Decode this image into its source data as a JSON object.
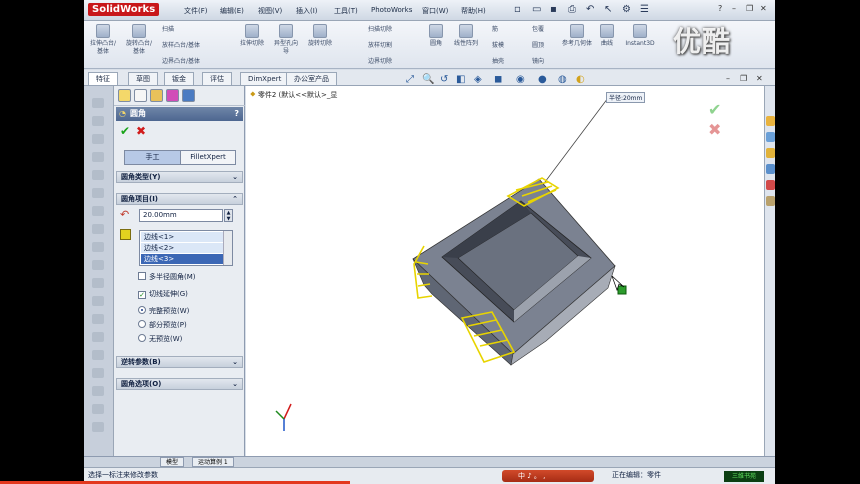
{
  "app": {
    "logo": "SolidWorks"
  },
  "menu": [
    "文件(F)",
    "编辑(E)",
    "视图(V)",
    "插入(I)",
    "工具(T)",
    "PhotoWorks",
    "窗口(W)",
    "帮助(H)"
  ],
  "watermark": "优酷",
  "ribbon": {
    "buttons": [
      "拉伸凸台/基体",
      "旋转凸台/基体",
      "拉伸切除",
      "异型孔向导",
      "旋转切除",
      "圆角",
      "线性阵列",
      "筋",
      "拔模",
      "包覆",
      "参考几何体",
      "曲线",
      "Instant3D"
    ],
    "small": [
      "扫描",
      "放样凸台/基体",
      "边界凸台/基体",
      "扫描切除",
      "放样切割",
      "边界切除",
      "圆顶",
      "抽壳",
      "镜向"
    ]
  },
  "tabs": [
    "特征",
    "草图",
    "钣金",
    "评估",
    "DimXpert",
    "办公室产品"
  ],
  "pm": {
    "title": "圆角",
    "help": "?",
    "mode_manual": "手工",
    "mode_auto": "FilletXpert",
    "group_type": "圆角类型(Y)",
    "group_items": "圆角项目(I)",
    "radius": "20.00mm",
    "edges": [
      "边线<1>",
      "边线<2>",
      "边线<3>"
    ],
    "multi_radius": "多半径圆角(M)",
    "tangent": "切线延伸(G)",
    "full_preview": "完整预览(W)",
    "partial_preview": "部分预览(P)",
    "no_preview": "无预览(W)",
    "group_setback": "逆转参数(B)",
    "group_options": "圆角选项(O)"
  },
  "viewport": {
    "tree_label": "零件2  (默认<<默认>_显",
    "dimension_label": "半径:20mm"
  },
  "bottom_tabs": [
    "模型",
    "运动算例 1"
  ],
  "status": {
    "hint": "选择一标注来修改参数",
    "ime": "中 ♪ 。 ,",
    "editing": "正在编辑：零件",
    "badge": "三维书苑"
  }
}
